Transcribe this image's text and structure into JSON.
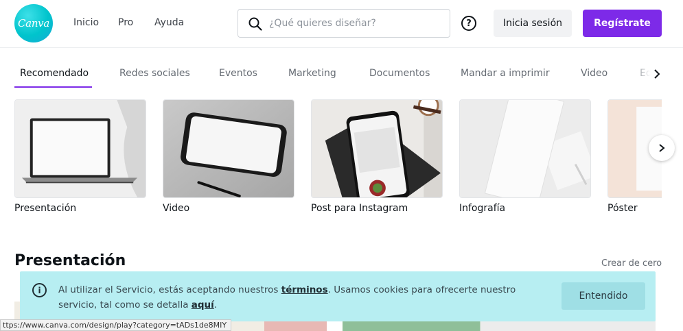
{
  "header": {
    "logo_text": "Canva",
    "nav": [
      "Inicio",
      "Pro",
      "Ayuda"
    ],
    "search_placeholder": "¿Qué quieres diseñar?",
    "help_icon": "?",
    "login_label": "Inicia sesión",
    "signup_label": "Regístrate"
  },
  "tabs": {
    "items": [
      "Recomendado",
      "Redes sociales",
      "Eventos",
      "Marketing",
      "Documentos",
      "Mandar a imprimir",
      "Video",
      "Ed"
    ],
    "active_index": 0
  },
  "cards": [
    "Presentación",
    "Video",
    "Post para Instagram",
    "Infografía",
    "Póster"
  ],
  "section": {
    "title": "Presentación",
    "create_link": "Crear de cero"
  },
  "cookie": {
    "info_icon": "i",
    "text_before": "Al utilizar el Servicio, estás aceptando nuestros ",
    "link_terms": "términos",
    "text_middle": ". Usamos cookies para ofrecerte nuestro servicio, tal como se detalla ",
    "link_here": "aquí",
    "text_after": ".",
    "button_label": "Entendido"
  },
  "status_url": "ttps://www.canva.com/design/play?category=tADs1de8MIY",
  "colors": {
    "accent": "#7d2ae8",
    "logo": "#00c4cc",
    "cookie_bg": "#b7eef2"
  }
}
